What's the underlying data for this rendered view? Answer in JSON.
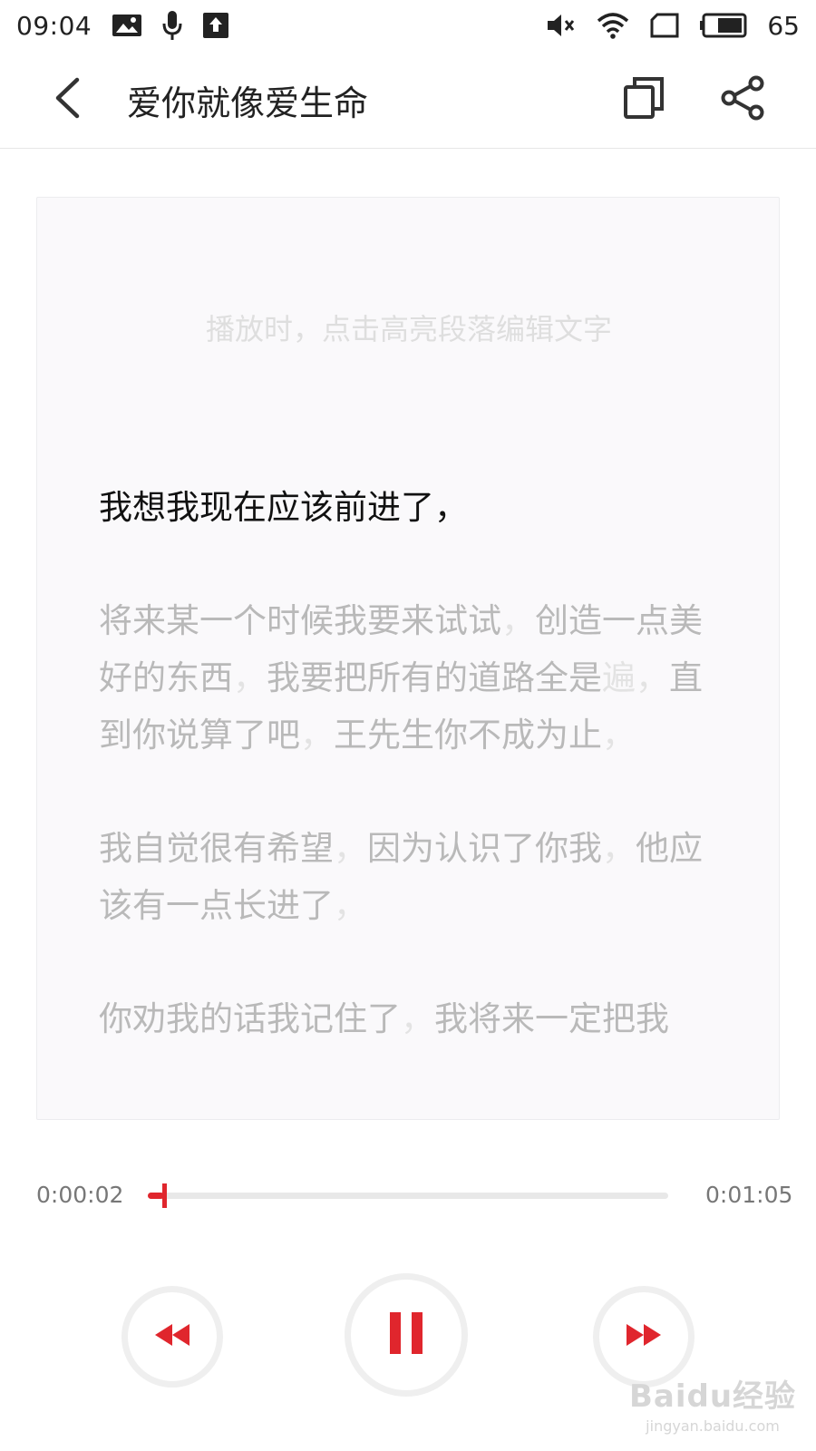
{
  "status_bar": {
    "time": "09:04",
    "battery": "65",
    "icons": [
      "image-icon",
      "mic-icon",
      "upload-icon",
      "mute-icon",
      "wifi-icon",
      "sim-icon",
      "battery-icon"
    ]
  },
  "header": {
    "title": "爱你就像爱生命",
    "icons": [
      "back-arrow-icon",
      "copy-icon",
      "share-icon"
    ]
  },
  "transcript": {
    "hint": "播放时，点击高亮段落编辑文字",
    "paragraphs": [
      {
        "segments": [
          {
            "text": "我想我现在应该前进了，",
            "faint": false
          }
        ]
      },
      {
        "segments": [
          {
            "text": "将来某一个时候我要来试试",
            "faint": false
          },
          {
            "text": "，",
            "faint": true
          },
          {
            "text": "创造一点美好的东西",
            "faint": false
          },
          {
            "text": "，",
            "faint": true
          },
          {
            "text": "我要把所有的道路全是",
            "faint": false
          },
          {
            "text": "遍",
            "faint": true
          },
          {
            "text": "，",
            "faint": true
          },
          {
            "text": "直到你说算了吧",
            "faint": false
          },
          {
            "text": "，",
            "faint": true
          },
          {
            "text": "王先生你不成为止",
            "faint": false
          },
          {
            "text": "，",
            "faint": true
          }
        ]
      },
      {
        "segments": [
          {
            "text": "我自觉很有希望",
            "faint": false
          },
          {
            "text": "，",
            "faint": true
          },
          {
            "text": "因为认识了你我",
            "faint": false
          },
          {
            "text": "，",
            "faint": true
          },
          {
            "text": "他应该有一点长进了",
            "faint": false
          },
          {
            "text": "，",
            "faint": true
          }
        ]
      },
      {
        "segments": [
          {
            "text": "你劝我的话我记住了",
            "faint": false
          },
          {
            "text": "，",
            "faint": true
          },
          {
            "text": "我将来一定把我",
            "faint": false
          }
        ]
      }
    ]
  },
  "player": {
    "current_time": "0:00:02",
    "total_time": "0:01:05",
    "progress_fraction": 0.031,
    "accent_color": "#e0262d",
    "controls": [
      "rewind-icon",
      "pause-icon",
      "fast-forward-icon"
    ]
  },
  "watermark": {
    "logo": "Baidu经验",
    "url": "jingyan.baidu.com"
  }
}
